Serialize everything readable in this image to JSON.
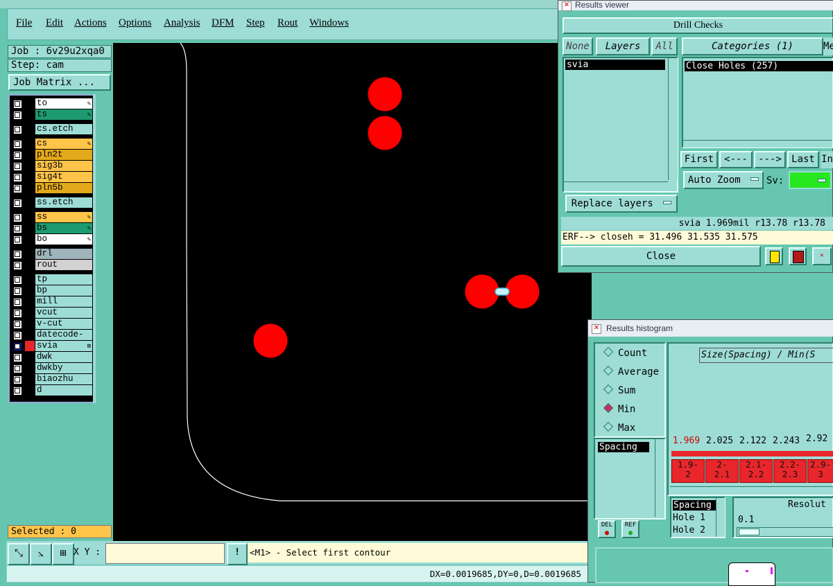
{
  "menu": [
    "File",
    "Edit",
    "Actions",
    "Options",
    "Analysis",
    "DFM",
    "Step",
    "Rout",
    "Windows"
  ],
  "job": {
    "job_label": "Job : 6v29u2xqa0",
    "step_label": "Step: cam",
    "matrix_button": "Job Matrix ..."
  },
  "layers": [
    {
      "name": "to",
      "color": "#ffffff",
      "mark": "✎"
    },
    {
      "name": "ts",
      "color": "#1e9a70",
      "mark": "✎"
    },
    {
      "name": "cs.etch",
      "color": "#9edcd6",
      "mark": ""
    },
    {
      "name": "cs",
      "color": "#ffc44a",
      "mark": "✎"
    },
    {
      "name": "pln2t",
      "color": "#e3a91a",
      "mark": ""
    },
    {
      "name": "sig3b",
      "color": "#ffc44a",
      "mark": ""
    },
    {
      "name": "sig4t",
      "color": "#ffc44a",
      "mark": ""
    },
    {
      "name": "pln5b",
      "color": "#e3a91a",
      "mark": ""
    },
    {
      "name": "ss.etch",
      "color": "#9edcd6",
      "mark": ""
    },
    {
      "name": "ss",
      "color": "#ffc44a",
      "mark": "✎"
    },
    {
      "name": "bs",
      "color": "#1e9a70",
      "mark": "✎"
    },
    {
      "name": "bo",
      "color": "#ffffff",
      "mark": "✎"
    },
    {
      "name": "drl",
      "color": "#9fb4bb",
      "mark": ""
    },
    {
      "name": "rout",
      "color": "#d2d2d2",
      "mark": ""
    },
    {
      "name": "tp",
      "color": "#9edcd6",
      "mark": ""
    },
    {
      "name": "bp",
      "color": "#9edcd6",
      "mark": ""
    },
    {
      "name": "mill",
      "color": "#9edcd6",
      "mark": ""
    },
    {
      "name": "vcut",
      "color": "#9edcd6",
      "mark": ""
    },
    {
      "name": "v-cut",
      "color": "#9edcd6",
      "mark": ""
    },
    {
      "name": "datecode-pte",
      "color": "#9edcd6",
      "mark": ""
    },
    {
      "name": "svia",
      "color": "#9edcd6",
      "mark": "⊞"
    },
    {
      "name": "dwk",
      "color": "#9edcd6",
      "mark": ""
    },
    {
      "name": "dwkby",
      "color": "#9edcd6",
      "mark": ""
    },
    {
      "name": "biaozhu",
      "color": "#9edcd6",
      "mark": ""
    },
    {
      "name": "d",
      "color": "#9edcd6",
      "mark": ""
    }
  ],
  "selected_label": "Selected : 0",
  "bottom": {
    "xy_label": "X Y :",
    "prompt": "<M1> - Select first contour",
    "status": "DX=0.0019685,DY=0,D=0.0019685"
  },
  "results_viewer": {
    "title": "Results viewer",
    "header": "Drill Checks",
    "none_btn": "None",
    "layers_btn": "Layers",
    "all_btn": "All",
    "categories_btn": "Categories (1)",
    "more_btn": "Me",
    "layer_item": "svia",
    "category_item": "Close Holes (257)",
    "first_btn": "First",
    "prev_btn": "<---",
    "next_btn": "--->",
    "last_btn": "Last",
    "in_btn": "In",
    "autozoom_btn": "Auto Zoom",
    "sv_label": "Sv:",
    "replace_btn": "Replace layers",
    "info_line": "svia 1.969mil  r13.78  r13.78",
    "erf_line": "ERF--> closeh = 31.496 31.535 31.575",
    "close_btn": "Close"
  },
  "histogram": {
    "title": "Results histogram",
    "options": [
      "Count",
      "Average",
      "Sum",
      "Min",
      "Max"
    ],
    "selected_option": "Min",
    "header": "Size(Spacing) / Min(S",
    "list_item": "Spacing",
    "del_btn": "DEL",
    "ref_btn": "REF",
    "values": [
      "1.969",
      "2.025",
      "2.122",
      "2.243",
      "2.92"
    ],
    "bins": [
      [
        "1.9-",
        "2"
      ],
      [
        "2-",
        "2.1"
      ],
      [
        "2.1-",
        "2.2"
      ],
      [
        "2.2-",
        "2.3"
      ],
      [
        "2.9-",
        "3"
      ]
    ],
    "fields": [
      "Spacing",
      "Hole 1",
      "Hole 2"
    ],
    "resolution_label": "Resolut",
    "resolution_value": "0.1"
  },
  "colors": {
    "accent": "#66c6b0",
    "panel": "#9edcd6",
    "hole": "#ff0000",
    "highlight": "#ffc44a"
  }
}
